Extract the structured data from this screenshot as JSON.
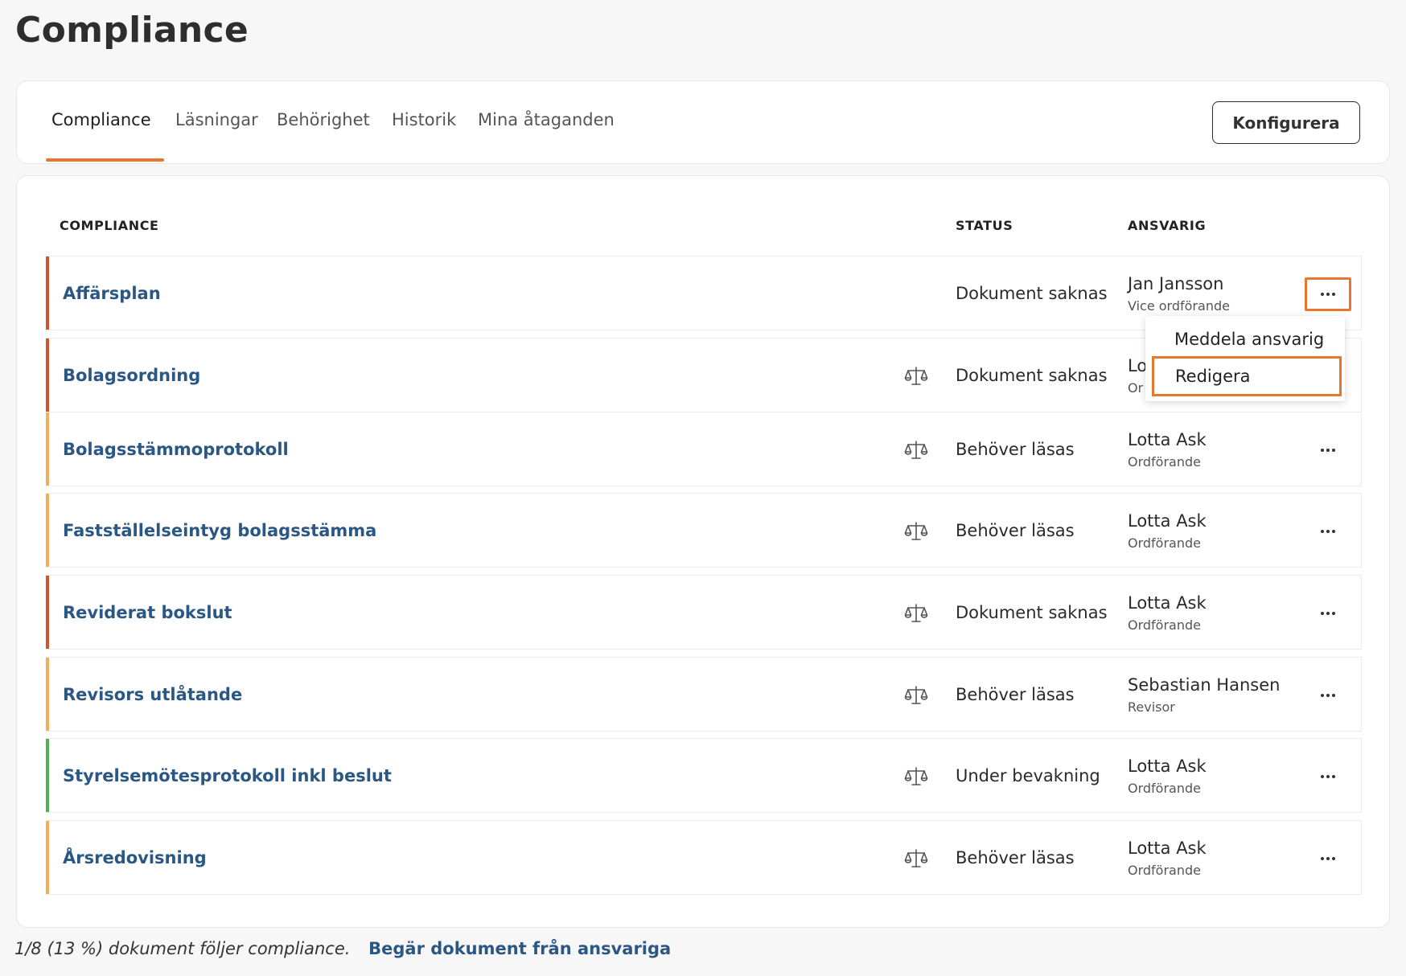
{
  "page_title": "Compliance",
  "tabs": [
    {
      "label": "Compliance",
      "active": true
    },
    {
      "label": "Läsningar",
      "active": false
    },
    {
      "label": "Behörighet",
      "active": false
    },
    {
      "label": "Historik",
      "active": false
    },
    {
      "label": "Mina åtaganden",
      "active": false
    }
  ],
  "configure_button": "Konfigurera",
  "table": {
    "headers": {
      "compliance": "COMPLIANCE",
      "status": "STATUS",
      "responsible": "ANSVARIG"
    },
    "rows": [
      {
        "name": "Affärsplan",
        "status": "Dokument saknas",
        "responsible": "Jan Jansson",
        "role": "Vice ordförande",
        "indicator_color": "#d2552e",
        "law_icon": false
      },
      {
        "name": "Bolagsordning",
        "status": "Dokument saknas",
        "responsible": "Lo",
        "role": "Or",
        "indicator_color": "#d2552e",
        "law_icon": true
      },
      {
        "name": "Bolagsstämmoprotokoll",
        "status": "Behöver läsas",
        "responsible": "Lotta Ask",
        "role": "Ordförande",
        "indicator_color": "#f2ae5b",
        "law_icon": true
      },
      {
        "name": "Fastställelseintyg bolagsstämma",
        "status": "Behöver läsas",
        "responsible": "Lotta Ask",
        "role": "Ordförande",
        "indicator_color": "#f2ae5b",
        "law_icon": true
      },
      {
        "name": "Reviderat bokslut",
        "status": "Dokument saknas",
        "responsible": "Lotta Ask",
        "role": "Ordförande",
        "indicator_color": "#d2552e",
        "law_icon": true
      },
      {
        "name": "Revisors utlåtande",
        "status": "Behöver läsas",
        "responsible": "Sebastian Hansen",
        "role": "Revisor",
        "indicator_color": "#f2ae5b",
        "law_icon": true
      },
      {
        "name": "Styrelsemötesprotokoll inkl beslut",
        "status": "Under bevakning",
        "responsible": "Lotta Ask",
        "role": "Ordförande",
        "indicator_color": "#4caf50",
        "law_icon": true
      },
      {
        "name": "Årsredovisning",
        "status": "Behöver läsas",
        "responsible": "Lotta Ask",
        "role": "Ordförande",
        "indicator_color": "#f2ae5b",
        "law_icon": true
      }
    ]
  },
  "row_menu": {
    "items": [
      "Meddela ansvarig",
      "Redigera"
    ],
    "highlighted": "Redigera"
  },
  "footer": {
    "summary": "1/8 (13 %) dokument följer compliance.",
    "link": "Begär dokument från ansvariga"
  },
  "colors": {
    "accent": "#e8762c",
    "link": "#2a5783"
  }
}
